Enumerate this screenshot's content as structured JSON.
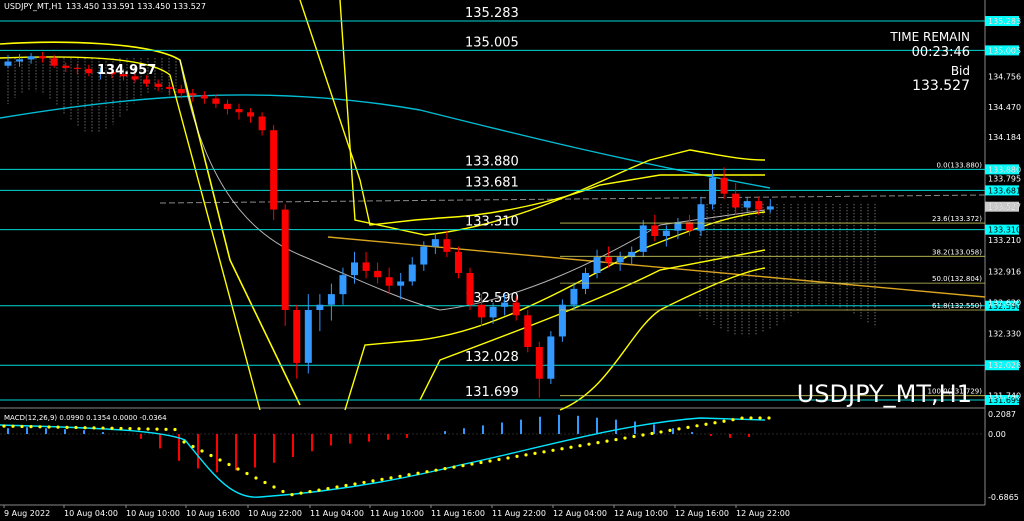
{
  "header": {
    "symbol_info": "USDJPY_MT,H1",
    "ohlc": "133.450 133.591 133.450 133.527"
  },
  "info_panel": {
    "time_remain_label": "TIME REMAIN",
    "time_remain_value": "00:23:46",
    "bid_label": "Bid",
    "bid_value": "133.527"
  },
  "watermark": "USDJPY_MT,H1",
  "macd_label": "MACD(12,26,9) 0.0990 0.1354 0.0000 -0.0364",
  "price_axis_ticks": [
    "135.283",
    "135.005",
    "134.756",
    "134.470",
    "134.184",
    "133.880",
    "133.795",
    "133.527",
    "133.210",
    "132.916",
    "132.620",
    "132.330",
    "132.028",
    "131.740"
  ],
  "macd_axis_ticks": [
    "0.2087",
    "0.00",
    "-0.6865"
  ],
  "levels": [
    {
      "name": "level-135-283",
      "value": 135.283,
      "label": "135.283",
      "tag": "135.283",
      "color": "#00d7d7",
      "tag_bg": "#00ffff"
    },
    {
      "name": "level-135-005",
      "value": 135.005,
      "label": "135.005",
      "tag": "135.005",
      "color": "#00d7d7",
      "tag_bg": "#00ffff"
    },
    {
      "name": "level-133-880",
      "value": 133.88,
      "label": "133.880",
      "tag": "133.880",
      "color": "#00d7d7",
      "tag_bg": "#00ffff"
    },
    {
      "name": "level-133-681",
      "value": 133.681,
      "label": "133.681",
      "tag": "133.681",
      "color": "#00d7d7",
      "tag_bg": "#00ffff"
    },
    {
      "name": "level-133-310",
      "value": 133.31,
      "label": "133.310",
      "tag": "133.310",
      "color": "#00d7d7",
      "tag_bg": "#00ffff"
    },
    {
      "name": "level-132-590",
      "value": 132.59,
      "label": "132.590",
      "tag": "132.590",
      "color": "#00d7d7",
      "tag_bg": "#00ffff"
    },
    {
      "name": "level-132-028",
      "value": 132.028,
      "label": "132.028",
      "tag": "132.028",
      "color": "#00d7d7",
      "tag_bg": "#00ffff"
    },
    {
      "name": "level-131-699",
      "value": 131.699,
      "label": "131.699",
      "tag": "131.699",
      "color": "#00d7d7",
      "tag_bg": "#00ffff"
    }
  ],
  "fib_labels": [
    {
      "value": 133.88,
      "text": "0.0(133.880)"
    },
    {
      "value": 133.372,
      "text": "23.6(133.372)"
    },
    {
      "value": 133.058,
      "text": "38.2(133.058)"
    },
    {
      "value": 132.804,
      "text": "50.0(132.804)"
    },
    {
      "value": 132.55,
      "text": "61.8(132.550)"
    },
    {
      "value": 131.74,
      "text": "100.0(131.729)"
    }
  ],
  "current_price_tag": "133.527",
  "old_price_marker": "134.957",
  "time_labels": [
    "9 Aug 2022",
    "10 Aug 04:00",
    "10 Aug 10:00",
    "10 Aug 16:00",
    "10 Aug 22:00",
    "11 Aug 04:00",
    "11 Aug 10:00",
    "11 Aug 16:00",
    "11 Aug 22:00",
    "12 Aug 04:00",
    "12 Aug 10:00",
    "12 Aug 16:00",
    "12 Aug 22:00"
  ],
  "colors": {
    "bull": "#3399ff",
    "bear": "#ff0000",
    "level": "#00d7d7",
    "bands": "#ffff00",
    "ma": "#00bcd4",
    "trendline": "#daa520",
    "macd_signal": "#ffff00",
    "macd_line": "#00e5ff"
  },
  "chart_data": {
    "type": "candlestick",
    "symbol": "USDJPY_MT",
    "timeframe": "H1",
    "ylim": [
      131.69,
      135.35
    ],
    "candles_ohlc": [
      [
        134.86,
        134.96,
        134.84,
        134.9
      ],
      [
        134.9,
        134.97,
        134.85,
        134.92
      ],
      [
        134.92,
        134.98,
        134.88,
        134.95
      ],
      [
        134.95,
        134.99,
        134.89,
        134.93
      ],
      [
        134.93,
        134.96,
        134.84,
        134.86
      ],
      [
        134.86,
        134.89,
        134.8,
        134.84
      ],
      [
        134.84,
        134.88,
        134.78,
        134.83
      ],
      [
        134.83,
        134.87,
        134.76,
        134.79
      ],
      [
        134.79,
        134.84,
        134.73,
        134.8
      ],
      [
        134.8,
        134.86,
        134.74,
        134.78
      ],
      [
        134.78,
        134.83,
        134.72,
        134.76
      ],
      [
        134.76,
        134.8,
        134.7,
        134.73
      ],
      [
        134.73,
        134.77,
        134.66,
        134.69
      ],
      [
        134.69,
        134.73,
        134.62,
        134.66
      ],
      [
        134.66,
        134.7,
        134.58,
        134.64
      ],
      [
        134.64,
        134.68,
        134.55,
        134.6
      ],
      [
        134.6,
        134.64,
        134.52,
        134.58
      ],
      [
        134.58,
        134.62,
        134.5,
        134.55
      ],
      [
        134.55,
        134.59,
        134.46,
        134.5
      ],
      [
        134.5,
        134.54,
        134.4,
        134.45
      ],
      [
        134.45,
        134.5,
        134.35,
        134.42
      ],
      [
        134.42,
        134.46,
        134.32,
        134.38
      ],
      [
        134.38,
        134.42,
        134.2,
        134.25
      ],
      [
        134.25,
        134.3,
        133.4,
        133.5
      ],
      [
        133.5,
        133.55,
        132.4,
        132.55
      ],
      [
        132.55,
        132.6,
        131.9,
        132.05
      ],
      [
        132.05,
        132.7,
        131.95,
        132.55
      ],
      [
        132.55,
        132.7,
        132.35,
        132.6
      ],
      [
        132.6,
        132.8,
        132.45,
        132.7
      ],
      [
        132.7,
        132.95,
        132.6,
        132.88
      ],
      [
        132.88,
        133.1,
        132.8,
        133.0
      ],
      [
        133.0,
        133.1,
        132.85,
        132.92
      ],
      [
        132.92,
        133.0,
        132.8,
        132.86
      ],
      [
        132.86,
        132.95,
        132.7,
        132.78
      ],
      [
        132.78,
        132.9,
        132.65,
        132.82
      ],
      [
        132.82,
        133.05,
        132.78,
        132.98
      ],
      [
        132.98,
        133.2,
        132.92,
        133.15
      ],
      [
        133.15,
        133.28,
        133.08,
        133.22
      ],
      [
        133.22,
        133.3,
        133.05,
        133.1
      ],
      [
        133.1,
        133.15,
        132.85,
        132.9
      ],
      [
        132.9,
        132.95,
        132.55,
        132.6
      ],
      [
        132.6,
        132.7,
        132.4,
        132.48
      ],
      [
        132.48,
        132.62,
        132.42,
        132.58
      ],
      [
        132.58,
        132.7,
        132.5,
        132.62
      ],
      [
        132.62,
        132.68,
        132.45,
        132.5
      ],
      [
        132.5,
        132.55,
        132.15,
        132.2
      ],
      [
        132.2,
        132.25,
        131.72,
        131.9
      ],
      [
        131.9,
        132.35,
        131.85,
        132.3
      ],
      [
        132.3,
        132.65,
        132.25,
        132.6
      ],
      [
        132.6,
        132.8,
        132.55,
        132.75
      ],
      [
        132.75,
        132.95,
        132.7,
        132.9
      ],
      [
        132.9,
        133.12,
        132.85,
        133.05
      ],
      [
        133.05,
        133.15,
        132.95,
        133.0
      ],
      [
        133.0,
        133.1,
        132.92,
        133.05
      ],
      [
        133.05,
        133.15,
        132.98,
        133.1
      ],
      [
        133.1,
        133.4,
        133.05,
        133.35
      ],
      [
        133.35,
        133.45,
        133.2,
        133.25
      ],
      [
        133.25,
        133.35,
        133.15,
        133.3
      ],
      [
        133.3,
        133.42,
        133.22,
        133.38
      ],
      [
        133.38,
        133.45,
        133.25,
        133.3
      ],
      [
        133.3,
        133.62,
        133.25,
        133.55
      ],
      [
        133.55,
        133.88,
        133.5,
        133.8
      ],
      [
        133.8,
        133.9,
        133.6,
        133.65
      ],
      [
        133.65,
        133.75,
        133.45,
        133.52
      ],
      [
        133.52,
        133.62,
        133.48,
        133.58
      ],
      [
        133.58,
        133.62,
        133.45,
        133.5
      ],
      [
        133.5,
        133.6,
        133.47,
        133.53
      ]
    ],
    "macd_histogram": [
      0.06,
      0.07,
      0.06,
      0.05,
      0.04,
      0.02,
      0.0,
      -0.05,
      -0.15,
      -0.28,
      -0.36,
      -0.4,
      -0.38,
      -0.35,
      -0.3,
      -0.24,
      -0.18,
      -0.12,
      -0.1,
      -0.08,
      -0.06,
      -0.04,
      0.0,
      0.03,
      0.06,
      0.09,
      0.12,
      0.15,
      0.18,
      0.2,
      0.19,
      0.17,
      0.15,
      0.13,
      0.1,
      0.06,
      0.02,
      -0.02,
      -0.04,
      -0.03
    ],
    "macd_ylim": [
      -0.6865,
      0.2087
    ]
  }
}
